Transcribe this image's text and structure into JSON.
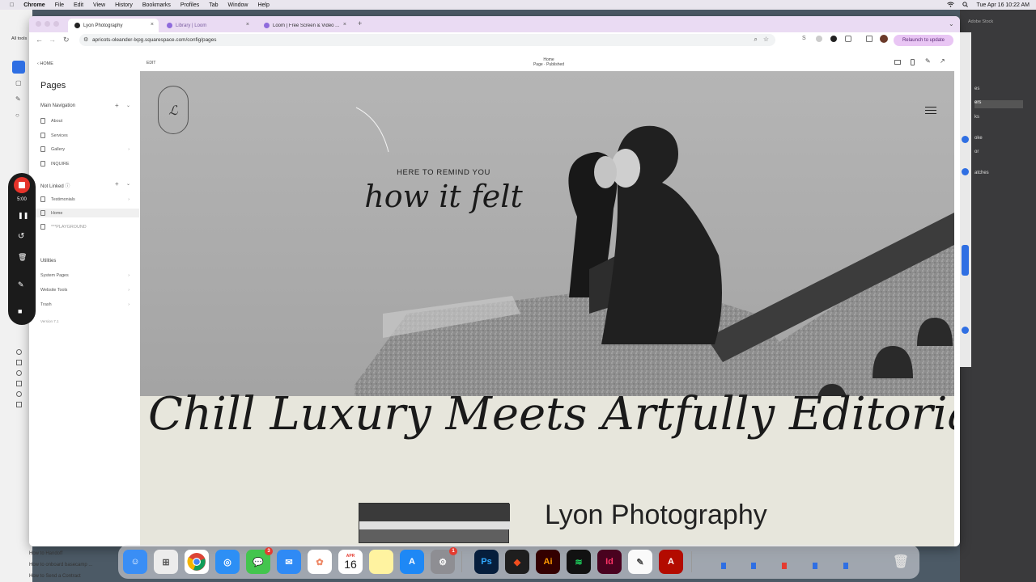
{
  "menubar": {
    "apple": "",
    "app": "Chrome",
    "items": [
      "File",
      "Edit",
      "View",
      "History",
      "Bookmarks",
      "Profiles",
      "Tab",
      "Window",
      "Help"
    ],
    "datetime": "Tue Apr 16  10:22 AM"
  },
  "browser": {
    "tabs": [
      {
        "label": "Lyon Photography"
      },
      {
        "label": "Library | Loom"
      },
      {
        "label": "Loom | Free Screen & Video ..."
      }
    ],
    "new_tab": "+",
    "url": "apricots-oleander-lxpg.squarespace.com/config/pages",
    "relaunch": "Relaunch to update"
  },
  "left_app": {
    "label": "All tools"
  },
  "right_app": {
    "label": "Adobe Stock",
    "items": [
      "es",
      "ers",
      "ks",
      "oke",
      "or",
      "atches"
    ]
  },
  "sidebar": {
    "back": "HOME",
    "title": "Pages",
    "main_nav_label": "Main Navigation",
    "main_nav": [
      {
        "label": "About"
      },
      {
        "label": "Services"
      },
      {
        "label": "Gallery"
      },
      {
        "label": "INQUIRE"
      }
    ],
    "not_linked_label": "Not Linked",
    "not_linked": [
      {
        "label": "Testimonials"
      },
      {
        "label": "Home"
      },
      {
        "label": "***PLAYGROUND"
      }
    ],
    "utilities_label": "Utilities",
    "utilities": [
      {
        "label": "System Pages"
      },
      {
        "label": "Website Tools"
      },
      {
        "label": "Trash"
      }
    ],
    "version": "Version 7.1"
  },
  "preview": {
    "edit": "EDIT",
    "page_title": "Home",
    "page_status": "Page · Published",
    "hero_subtitle": "HERE TO REMIND YOU",
    "hero_title": "how it felt",
    "marquee": "Chill Luxury Meets Artfully Editorial",
    "brand": "Lyon Photography"
  },
  "recorder": {
    "timer": "5:00"
  },
  "dock": {
    "calendar_month": "APR",
    "calendar_day": "16",
    "messages_badge": "3",
    "settings_badge": "1",
    "apps": [
      "Finder",
      "Launchpad",
      "Chrome",
      "Safari",
      "Messages",
      "Mail",
      "Photos",
      "Calendar",
      "Notes",
      "App Store",
      "System Settings",
      "Photoshop",
      "Figma",
      "Illustrator",
      "Spotify",
      "InDesign",
      "TextEdit",
      "Acrobat",
      "Trash"
    ]
  },
  "bottom_tasks": [
    "How to Handoff",
    "How to onboard basecamp ...",
    "How to Send a Contract"
  ],
  "colors": {
    "tabstrip": "#eadbf3",
    "relaunch_bg": "#e9c6f4",
    "band": "#e7e6dc",
    "record_red": "#e5332a"
  }
}
